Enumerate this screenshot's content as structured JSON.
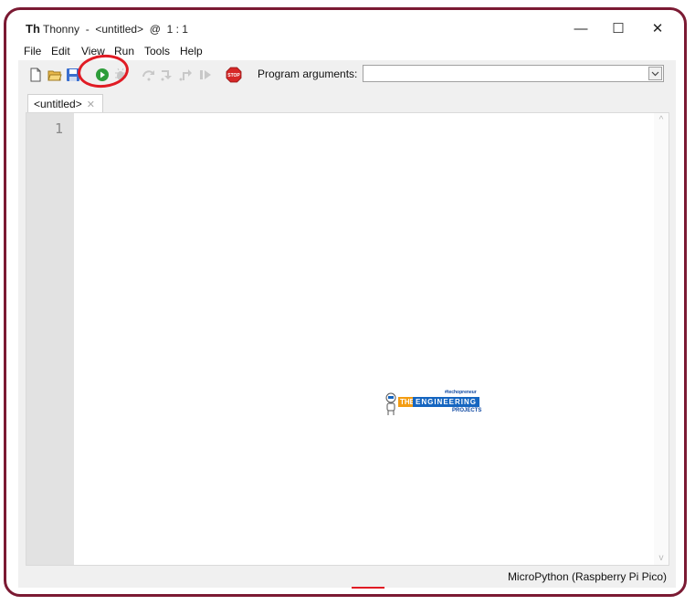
{
  "window": {
    "app_icon": "Th",
    "title": "Thonny  -  <untitled>  @  1 : 1",
    "controls": {
      "minimize": "—",
      "maximize": "☐",
      "close": "✕"
    }
  },
  "menu": [
    "File",
    "Edit",
    "View",
    "Run",
    "Tools",
    "Help"
  ],
  "toolbar": {
    "icons": [
      "new-file-icon",
      "open-file-icon",
      "save-file-icon",
      "run-icon",
      "debug-icon",
      "step-over-icon",
      "step-into-icon",
      "step-out-icon",
      "resume-icon",
      "stop-icon"
    ],
    "stop_label": "STOP",
    "program_arguments_label": "Program arguments:",
    "program_arguments_value": "",
    "dropdown_arrow": "⌄"
  },
  "tabs": [
    {
      "label": "<untitled>",
      "close": "✕",
      "active": true
    }
  ],
  "editor": {
    "line_numbers": [
      "1"
    ],
    "content": "",
    "scroll_up": "^",
    "scroll_down": "v"
  },
  "status": {
    "interpreter": "MicroPython (Raspberry Pi Pico)"
  },
  "watermark": {
    "tagline": "#techopreneur",
    "the": "THE",
    "engineering": "ENGINEERING",
    "projects": "PROJECTS"
  },
  "colors": {
    "frame": "#7b1a33",
    "annotation": "#e01b24",
    "run_green": "#2e9d3a",
    "stop_red": "#d62828"
  }
}
